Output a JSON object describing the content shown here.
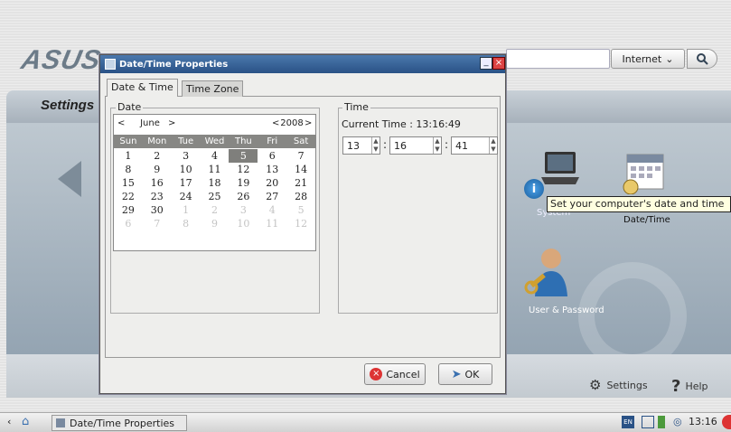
{
  "launcher": {
    "logo_text": "ASUS",
    "search_engine": "Internet",
    "search_placeholder": ""
  },
  "settings": {
    "title": "Settings",
    "items": [
      {
        "label": "System",
        "icon": "laptop-icon"
      },
      {
        "label": "Date/Time",
        "icon": "calendar-icon"
      },
      {
        "label": "User & Password",
        "icon": "user-key-icon"
      }
    ],
    "tooltip": "Set your computer's date and time",
    "footer_settings": "Settings",
    "footer_help": "Help"
  },
  "dialog": {
    "title": "Date/Time Properties",
    "tabs": [
      {
        "label": "Date & Time"
      },
      {
        "label": "Time Zone"
      }
    ],
    "date": {
      "legend": "Date",
      "month": "June",
      "year": "2008",
      "prev_month": "<",
      "next_month": ">",
      "prev_year": "<",
      "next_year": ">",
      "weekdays": [
        "Sun",
        "Mon",
        "Tue",
        "Wed",
        "Thu",
        "Fri",
        "Sat"
      ],
      "weeks": [
        [
          "1",
          "2",
          "3",
          "4",
          "5",
          "6",
          "7"
        ],
        [
          "8",
          "9",
          "10",
          "11",
          "12",
          "13",
          "14"
        ],
        [
          "15",
          "16",
          "17",
          "18",
          "19",
          "20",
          "21"
        ],
        [
          "22",
          "23",
          "24",
          "25",
          "26",
          "27",
          "28"
        ],
        [
          "29",
          "30",
          "1",
          "2",
          "3",
          "4",
          "5"
        ],
        [
          "6",
          "7",
          "8",
          "9",
          "10",
          "11",
          "12"
        ]
      ],
      "selected_day": "5"
    },
    "time": {
      "legend": "Time",
      "current_label": "Current Time : 13:16:49",
      "hour": "13",
      "minute": "16",
      "second": "41",
      "separator": ":"
    },
    "cancel_label": "Cancel",
    "ok_label": "OK"
  },
  "taskbar": {
    "task_label": "Date/Time Properties",
    "clock": "13:16",
    "lang": "EN"
  },
  "colors": {
    "titlebar": "#2a5286",
    "selected_day": "#7f7f7c",
    "accent": "#4a78ad"
  }
}
